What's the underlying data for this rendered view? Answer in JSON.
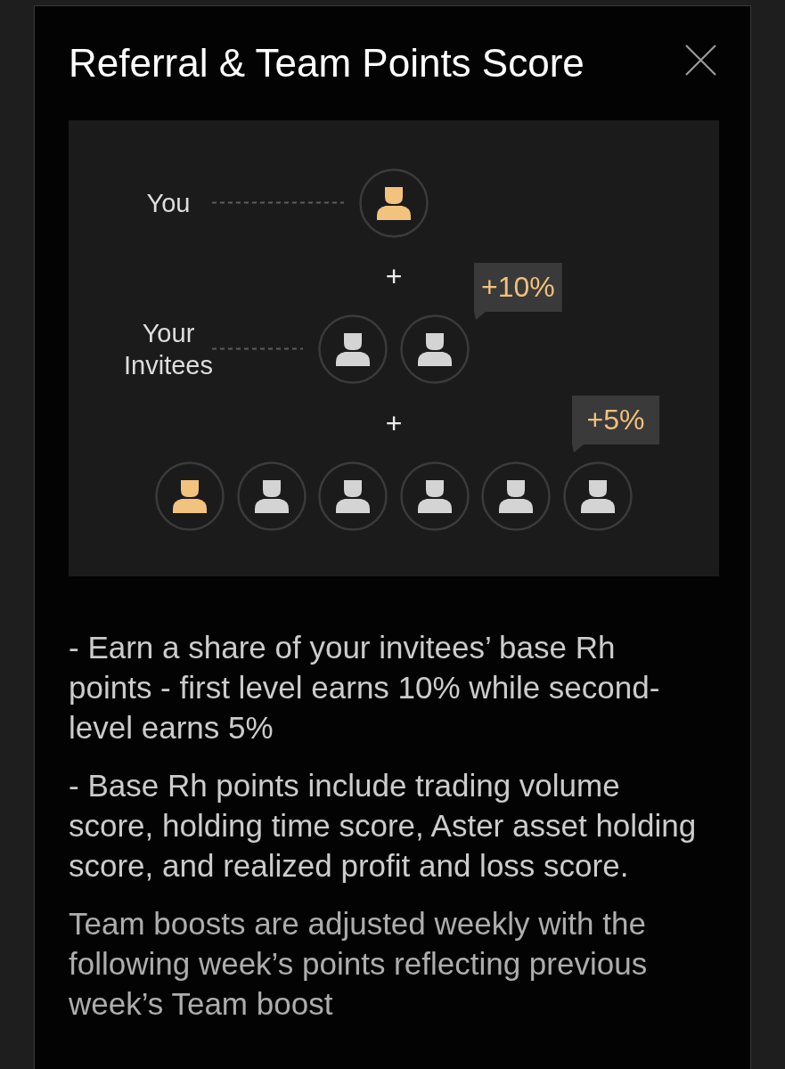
{
  "dialog": {
    "title": "Referral & Team Points Score"
  },
  "diagram": {
    "levels": [
      {
        "label": "You",
        "avatars": [
          {
            "highlighted": true
          }
        ]
      },
      {
        "joiner": "+",
        "label": "Your Invitees",
        "badge": "+10%",
        "avatars": [
          {
            "highlighted": false
          },
          {
            "highlighted": false
          }
        ]
      },
      {
        "joiner": "+",
        "badge": "+5%",
        "avatars": [
          {
            "highlighted": true
          },
          {
            "highlighted": false
          },
          {
            "highlighted": false
          },
          {
            "highlighted": false
          },
          {
            "highlighted": false
          },
          {
            "highlighted": false
          }
        ]
      }
    ]
  },
  "paragraphs": [
    {
      "kind": "point",
      "text": "- Earn a share of your invitees’ base Rh points - first level earns 10% while second-level earns 5%"
    },
    {
      "kind": "point",
      "text": "- Base Rh points include trading volume score, holding time score, Aster asset holding score, and realized profit and loss score."
    },
    {
      "kind": "note",
      "text": "Team boosts are adjusted weekly with the following week’s points reflecting previous week’s Team boost"
    }
  ]
}
